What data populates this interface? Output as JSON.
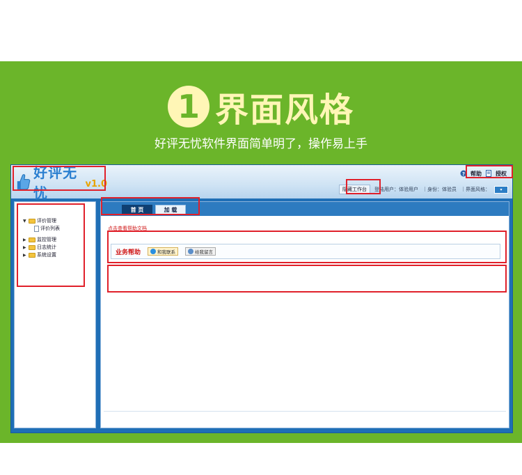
{
  "promo": {
    "step_number": "1",
    "title": "界面风格",
    "subtitle": "好评无忧软件界面简单明了，操作易上手"
  },
  "app": {
    "logo_text": "好评无忧",
    "logo_version": "v1.0",
    "header": {
      "help_label": "帮助",
      "license_label": "授权",
      "hide_workbench_label": "隐藏工作台",
      "login_user_text": "登陆用户：体验用户",
      "identity_text": "｜身份：体验员",
      "skin_label": "｜界面风格："
    },
    "sidebar": {
      "items": [
        {
          "label": "评价管理",
          "type": "folder",
          "expanded": true
        },
        {
          "label": "评价列表",
          "type": "doc",
          "child": true
        },
        {
          "label": "监控管理",
          "type": "folder",
          "expanded": false
        },
        {
          "label": "日志统计",
          "type": "folder",
          "expanded": false
        },
        {
          "label": "系统设置",
          "type": "folder",
          "expanded": false
        }
      ]
    },
    "tabs": [
      {
        "label": "首 页",
        "active": true
      },
      {
        "label": "加 载",
        "active": false
      }
    ],
    "main": {
      "help_doc_link": "点击查看帮助文档",
      "business_help_label": "业务帮助",
      "contact_button": "和我联系",
      "message_button": "给我留言"
    }
  },
  "colors": {
    "green_band": "#6bb52a",
    "title_yellow": "#fff6b6",
    "app_blue": "#1f6fb6",
    "annotation_red": "#e0202a"
  }
}
